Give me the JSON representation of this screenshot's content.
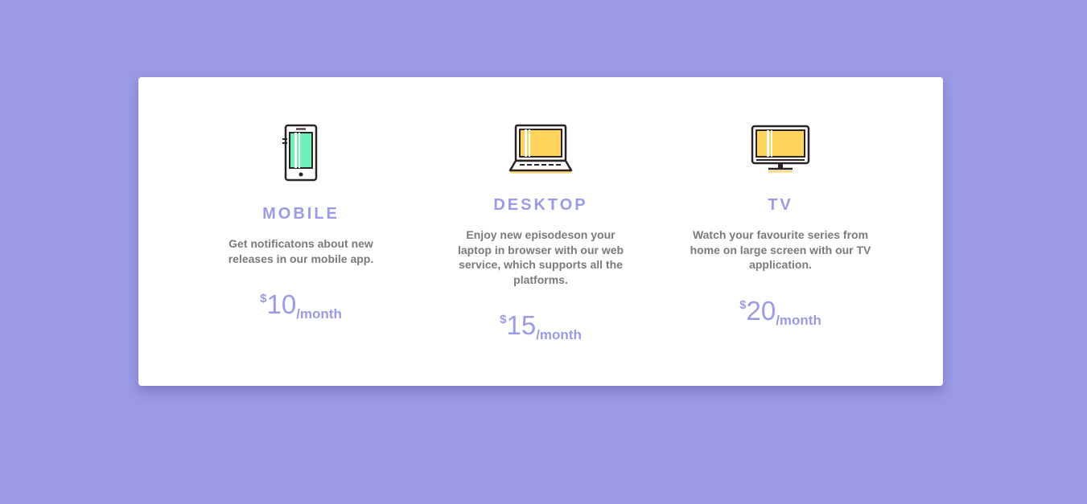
{
  "colors": {
    "background": "#9b9ae6",
    "accent": "#9b9ae6",
    "text_muted": "#7a7a7a",
    "mobile_screen": "#6ff0b8",
    "desktop_screen": "#ffd35c"
  },
  "plans": [
    {
      "icon": "mobile-phone-icon",
      "title": "MOBILE",
      "description": "Get notificatons about new releases in our mobile app.",
      "currency": "$",
      "amount": "10",
      "period": "/month"
    },
    {
      "icon": "laptop-icon",
      "title": "DESKTOP",
      "description": "Enjoy new episodeson your laptop in browser with our web service, which supports all the platforms.",
      "currency": "$",
      "amount": "15",
      "period": "/month"
    },
    {
      "icon": "tv-icon",
      "title": "TV",
      "description": "Watch your favourite series from home on large screen with our TV application.",
      "currency": "$",
      "amount": "20",
      "period": "/month"
    }
  ]
}
